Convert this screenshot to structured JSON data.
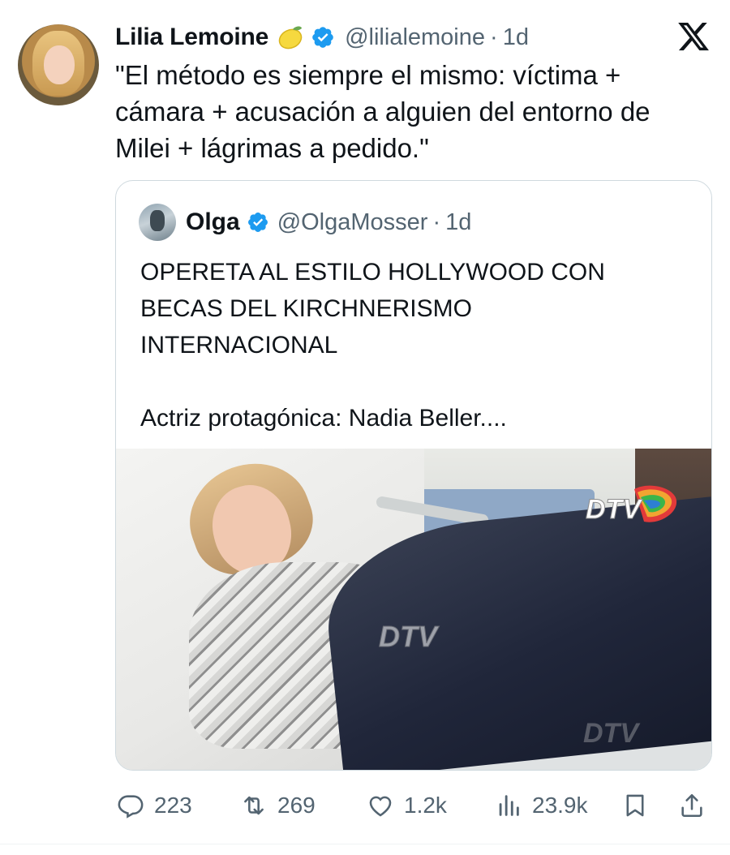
{
  "tweet": {
    "display_name": "Lilia Lemoine",
    "emoji": "lemon",
    "handle": "@lilialemoine",
    "separator": "·",
    "time": "1d",
    "text": "\"El método es siempre el mismo: víctima +\ncámara + acusación a alguien del entorno de\nMilei + lágrimas a pedido.\""
  },
  "quoted": {
    "display_name": "Olga",
    "handle": "@OlgaMosser",
    "separator": "·",
    "time": "1d",
    "text": "OPERETA AL ESTILO HOLLYWOOD CON\nBECAS DEL KIRCHNERISMO\nINTERNACIONAL\n\nActriz protagónica: Nadia Beller....",
    "media_watermark": "DTV"
  },
  "actions": {
    "replies": "223",
    "reposts": "269",
    "likes": "1.2k",
    "views": "23.9k"
  },
  "colors": {
    "verified": "#1d9bf0",
    "secondary_text": "#536471",
    "border": "#cfd9de"
  },
  "icons": [
    "x-logo-icon",
    "verified-badge-icon",
    "lemon-emoji-icon",
    "reply-icon",
    "repost-icon",
    "like-icon",
    "views-icon",
    "bookmark-icon",
    "share-icon"
  ]
}
